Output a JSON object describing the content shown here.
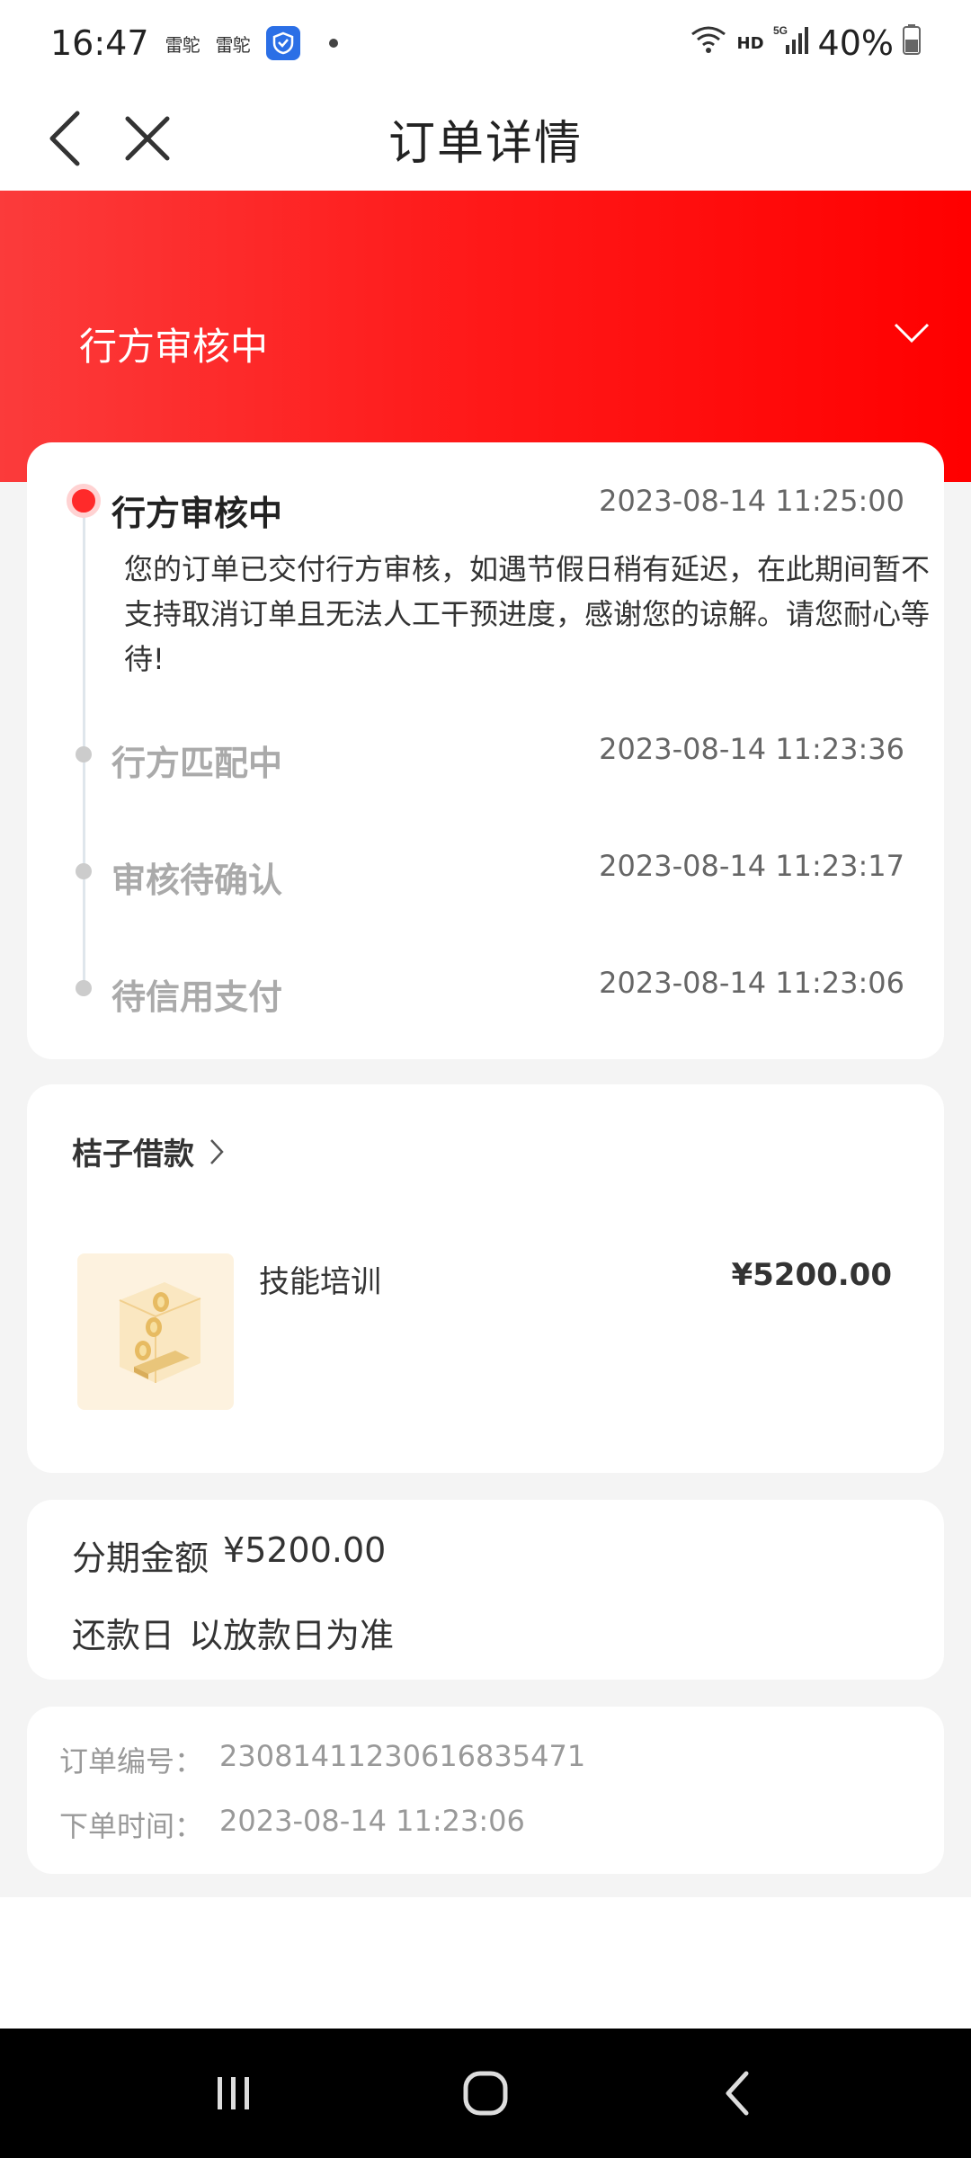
{
  "status_bar": {
    "time": "16:47",
    "carrier_1": "雷鸵",
    "carrier_2": "雷鸵",
    "network": "HD",
    "battery": "40%"
  },
  "nav": {
    "title": "订单详情"
  },
  "header": {
    "status": "行方审核中"
  },
  "timeline": [
    {
      "title": "行方审核中",
      "time": "2023-08-14 11:25:00",
      "description": "您的订单已交付行方审核，如遇节假日稍有延迟，在此期间暂不支持取消订单且无法人工干预进度，感谢您的谅解。请您耐心等待!",
      "active": true
    },
    {
      "title": "行方匹配中",
      "time": "2023-08-14 11:23:36",
      "active": false
    },
    {
      "title": "审核待确认",
      "time": "2023-08-14 11:23:17",
      "active": false
    },
    {
      "title": "待信用支付",
      "time": "2023-08-14 11:23:06",
      "active": false
    }
  ],
  "product": {
    "merchant": "桔子借款",
    "name": "技能培训",
    "price": "¥5200.00"
  },
  "installment": {
    "amount_label": "分期金额",
    "amount_value": "¥5200.00",
    "repay_label": "还款日",
    "repay_value": "以放款日为准"
  },
  "order_info": {
    "number_label": "订单编号：",
    "number_value": "23081411230616835471",
    "time_label": "下单时间：",
    "time_value": "2023-08-14 11:23:06"
  },
  "colors": {
    "accent_red": "#ff1818",
    "active_dot": "#ff2a2a"
  }
}
